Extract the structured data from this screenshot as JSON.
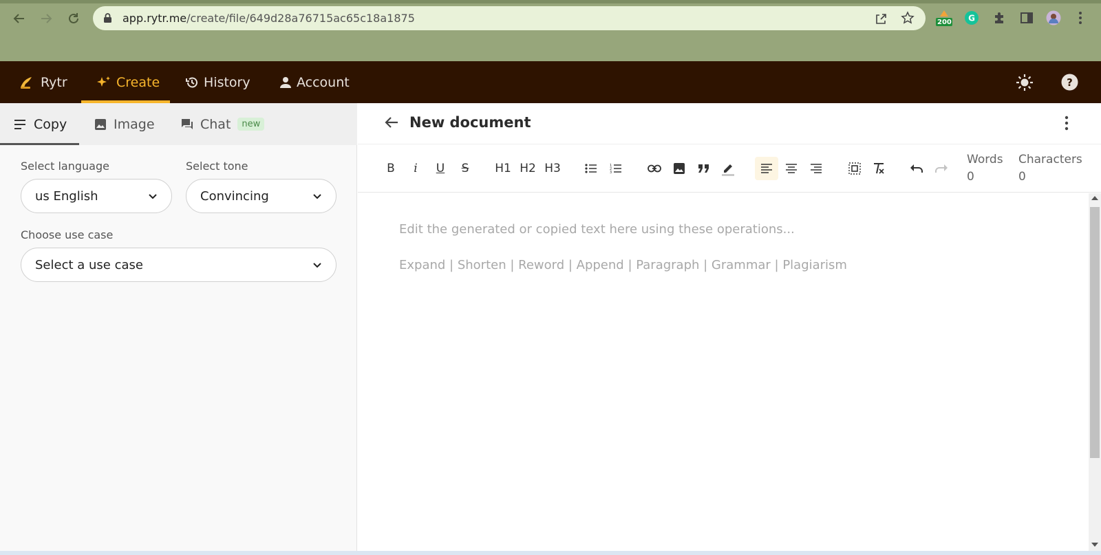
{
  "browser": {
    "url_domain": "app.rytr.me",
    "url_path": "/create/file/649d28a76715ac65c18a1875",
    "extension_badge": "200",
    "colors": {
      "frame": "#97a67b",
      "omnibox": "#e9f2d9"
    }
  },
  "header": {
    "logo_label": "Rytr",
    "nav": [
      {
        "label": "Create",
        "icon": "sparkle-icon",
        "active": true
      },
      {
        "label": "History",
        "icon": "history-icon"
      },
      {
        "label": "Account",
        "icon": "person-icon"
      }
    ],
    "colors": {
      "bar": "#2e1300",
      "accent": "#f7b52c"
    }
  },
  "left_panel": {
    "tabs": [
      {
        "label": "Copy",
        "icon": "lines-icon",
        "active": true
      },
      {
        "label": "Image",
        "icon": "image-icon"
      },
      {
        "label": "Chat",
        "icon": "chat-icon",
        "badge": "new"
      }
    ],
    "language": {
      "label": "Select language",
      "value": "us English"
    },
    "tone": {
      "label": "Select tone",
      "value": "Convincing"
    },
    "use_case": {
      "label": "Choose use case",
      "value": "Select a use case"
    }
  },
  "editor": {
    "title": "New document",
    "toolbar": {
      "bold": "B",
      "italic": "i",
      "underline": "U",
      "strike": "S",
      "h1": "H1",
      "h2": "H2",
      "h3": "H3"
    },
    "words_label": "Words",
    "words_value": "0",
    "characters_label": "Characters",
    "characters_value": "0",
    "placeholder_line1": "Edit the generated or copied text here using these operations...",
    "placeholder_line2": "Expand | Shorten | Reword | Append | Paragraph | Grammar | Plagiarism"
  }
}
